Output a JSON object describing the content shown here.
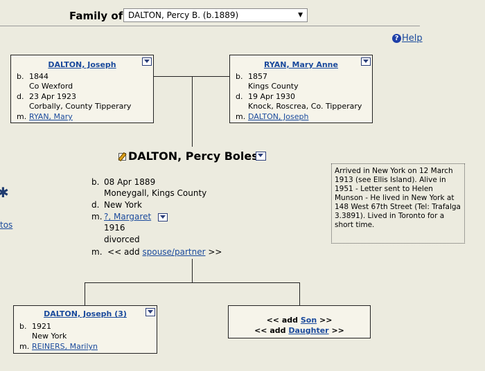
{
  "header": {
    "label": "Family of",
    "selected_person": "DALTON, Percy B. (b.1889)"
  },
  "help": {
    "label": "Help"
  },
  "left_edge": {
    "link_text": "tos"
  },
  "father": {
    "name": "DALTON, Joseph",
    "birth_label": "b.",
    "birth_date": "1844",
    "birth_place": "Co Wexford",
    "death_label": "d.",
    "death_date": "23 Apr 1923",
    "death_place": "Corbally, County Tipperary",
    "marriage_label": "m.",
    "spouse": "RYAN, Mary"
  },
  "mother": {
    "name": "RYAN, Mary Anne",
    "birth_label": "b.",
    "birth_date": "1857",
    "birth_place": "Kings County",
    "death_label": "d.",
    "death_date": "19 Apr 1930",
    "death_place": "Knock, Roscrea, Co. Tipperary",
    "marriage_label": "m.",
    "spouse": "DALTON, Joseph"
  },
  "focus": {
    "name": "DALTON, Percy Boles",
    "birth_label": "b.",
    "birth_date": "08 Apr 1889",
    "birth_place": "Moneygall, Kings County",
    "death_label": "d.",
    "death_place": "New York",
    "marriage_label": "m.",
    "spouse": "?, Margaret",
    "marriage_year": "1916",
    "marriage_status": "divorced",
    "add_prefix": "m.  << add",
    "add_link": "spouse/partner",
    "add_suffix": ">>",
    "note": "Arrived in New York on 12 March 1913 (see Ellis Island). Alive in 1951 - Letter sent to Helen Munson - He lived in New York at 148 West 67th Street (Tel: Trafalga 3.3891). Lived in Toronto for a short time."
  },
  "child": {
    "name": "DALTON, Joseph (3)",
    "birth_label": "b.",
    "birth_date": "1921",
    "birth_place": "New York",
    "marriage_label": "m.",
    "spouse": "REINERS, Marilyn"
  },
  "add_child": {
    "son_prefix": "<< add",
    "son_link": "Son",
    "son_suffix": ">>",
    "daughter_prefix": "<< add",
    "daughter_link": "Daughter",
    "daughter_suffix": ">>"
  }
}
